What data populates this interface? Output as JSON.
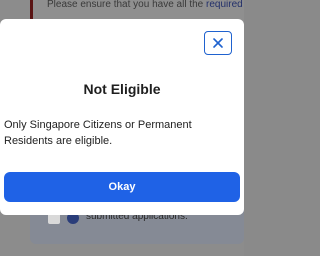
{
  "background": {
    "notice": {
      "text": "Please ensure that you have all the ",
      "link": "required"
    },
    "card": {
      "text": "submitted applications."
    }
  },
  "modal": {
    "close_icon": "close-icon",
    "title": "Not Eligible",
    "message": "Only Singapore Citizens or Permanent Residents are eligible.",
    "ok_label": "Okay"
  },
  "colors": {
    "accent": "#1f62e6",
    "overlay": "#8c8c8c"
  }
}
